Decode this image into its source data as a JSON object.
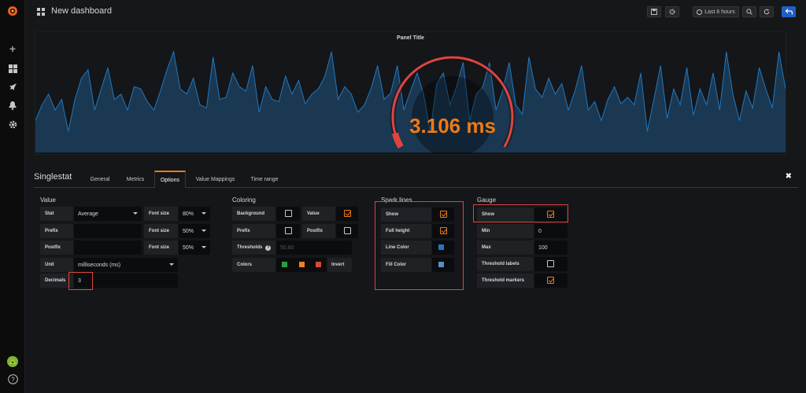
{
  "topbar": {
    "dashboard_title": "New dashboard",
    "time_range": "Last 6 hours"
  },
  "panel": {
    "title": "Panel Title",
    "value": "3.106 ms",
    "gauge_fraction": 0.031,
    "sparkline": [
      0.3,
      0.45,
      0.55,
      0.4,
      0.5,
      0.2,
      0.5,
      0.7,
      0.78,
      0.4,
      0.6,
      0.8,
      0.5,
      0.55,
      0.4,
      0.62,
      0.6,
      0.48,
      0.4,
      0.58,
      0.78,
      0.95,
      0.6,
      0.55,
      0.7,
      0.45,
      0.42,
      0.9,
      0.5,
      0.52,
      0.75,
      0.62,
      0.58,
      0.82,
      0.38,
      0.62,
      0.5,
      0.48,
      0.72,
      0.55,
      0.68,
      0.46,
      0.55,
      0.6,
      0.72,
      0.95,
      0.5,
      0.62,
      0.55,
      0.38,
      0.45,
      0.6,
      0.82,
      0.5,
      0.56,
      0.82,
      0.4,
      0.58,
      0.75,
      0.55,
      0.2,
      0.65,
      0.75,
      0.45,
      0.62,
      0.85,
      0.3,
      0.55,
      0.62,
      0.85,
      0.4,
      0.58,
      0.85,
      0.45,
      0.36,
      0.9,
      0.6,
      0.52,
      0.7,
      0.55,
      0.65,
      0.4,
      0.58,
      0.82,
      0.4,
      0.48,
      0.3,
      0.5,
      0.62,
      0.46,
      0.52,
      0.45,
      0.75,
      0.2,
      0.5,
      0.82,
      0.32,
      0.6,
      0.45,
      0.8,
      0.35,
      0.6,
      0.45,
      0.75,
      0.4,
      0.95,
      0.55,
      0.3,
      0.58,
      0.42,
      0.8,
      0.6,
      0.42,
      0.95,
      0.6
    ],
    "colors": {
      "value": "#eb7b18",
      "gauge": "#e0443e",
      "spark_line": "#1f78c1",
      "spark_fill": "#1b3852"
    }
  },
  "editor": {
    "title": "Singlestat",
    "tabs": [
      {
        "label": "General"
      },
      {
        "label": "Metrics"
      },
      {
        "label": "Options"
      },
      {
        "label": "Value Mappings"
      },
      {
        "label": "Time range"
      }
    ],
    "value_section": {
      "title": "Value",
      "stat_label": "Stat",
      "stat_value": "Average",
      "font_size_label": "Font size",
      "font_size_1": "80%",
      "font_size_2": "50%",
      "font_size_3": "50%",
      "prefix_label": "Prefix",
      "postfix_label": "Postfix",
      "unit_label": "Unit",
      "unit_value": "milliseconds (ms)",
      "decimals_label": "Decimals",
      "decimals_value": "3"
    },
    "coloring": {
      "title": "Coloring",
      "background_label": "Background",
      "background_checked": false,
      "value_label": "Value",
      "value_checked": true,
      "prefix_label": "Prefix",
      "prefix_checked": false,
      "postfix_label": "Postfix",
      "postfix_checked": false,
      "thresholds_label": "Thresholds",
      "thresholds_placeholder": "50,80",
      "colors_label": "Colors",
      "color_swatches": [
        "#299c46",
        "#ed8128",
        "#d44a3a"
      ],
      "invert_label": "Invert"
    },
    "spark_lines": {
      "title": "Spark lines",
      "show_label": "Show",
      "show_checked": true,
      "full_height_label": "Full height",
      "full_height_checked": true,
      "line_color_label": "Line Color",
      "line_color": "#1f78c1",
      "fill_color_label": "Fill Color",
      "fill_color": "#5b8fbe"
    },
    "gauge": {
      "title": "Gauge",
      "show_label": "Show",
      "show_checked": true,
      "min_label": "Min",
      "min_value": "0",
      "max_label": "Max",
      "max_value": "100",
      "threshold_labels_label": "Threshold labels",
      "threshold_labels_checked": false,
      "threshold_markers_label": "Threshold markers",
      "threshold_markers_checked": true
    }
  }
}
